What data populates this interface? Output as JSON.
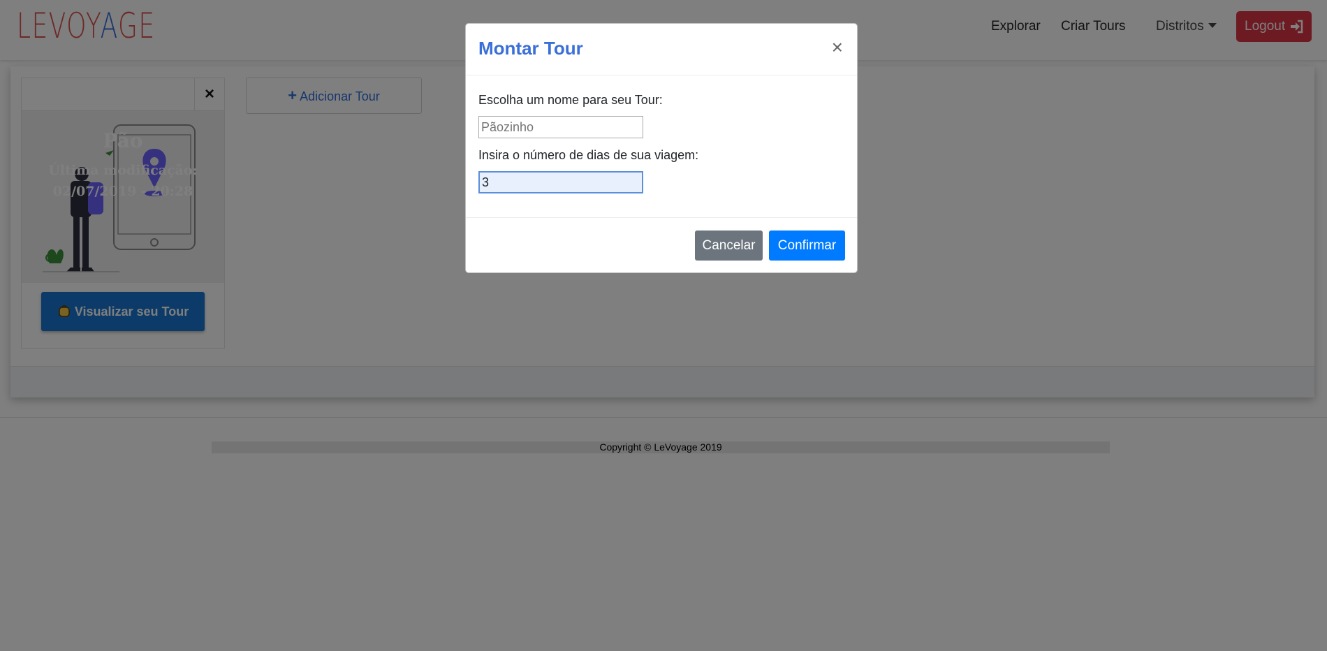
{
  "navbar": {
    "logo_text": "LEVOYAGE",
    "links": {
      "explorar": "Explorar",
      "criar_tours": "Criar Tours",
      "distritos": "Distritos"
    },
    "logout_label": "Logout",
    "colors": {
      "logo": "#d9534f",
      "logout": "#dc3545"
    }
  },
  "tour_card": {
    "close_symbol": "×",
    "title": "Pão",
    "modification_label": "Última modificação:",
    "modification_date": "02/07/2019 - 20:28",
    "view_button_label": "Visualizar seu Tour",
    "view_button_icon": "backpack-icon"
  },
  "add_tour_button": {
    "icon": "plus-icon",
    "label": "Adicionar Tour"
  },
  "footer": {
    "copyright": "Copyright © LeVoyage 2019"
  },
  "modal": {
    "title": "Montar Tour",
    "close_symbol": "×",
    "name_label": "Escolha um nome para seu Tour:",
    "name_placeholder": "Pãozinho",
    "days_label": "Insira o número de dias de sua viagem:",
    "days_value": "3",
    "cancel_label": "Cancelar",
    "confirm_label": "Confirmar",
    "colors": {
      "title": "#3a6fd8",
      "cancel": "#6c757d",
      "confirm": "#007bff"
    }
  }
}
